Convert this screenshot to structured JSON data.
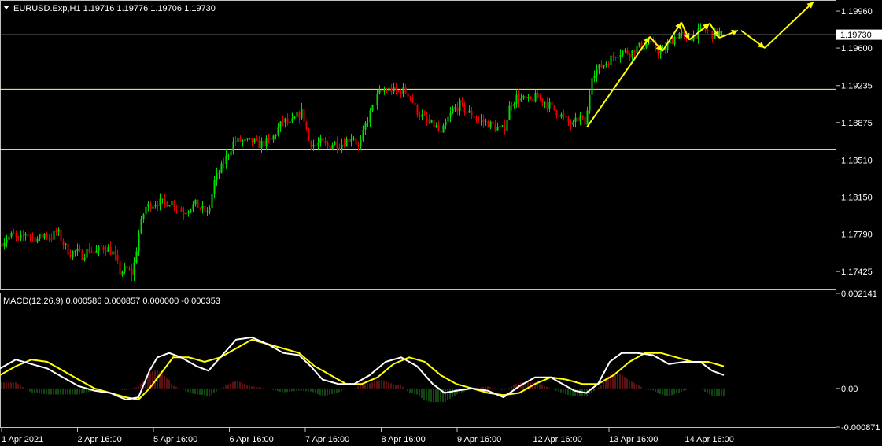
{
  "header": {
    "symbol_line": "EURUSD.Exp,H1  1.19716 1.19776 1.19706 1.19730",
    "macd_line": "MACD(12,26,9) 0.000586 0.000857 0.000000 -0.000353"
  },
  "colors": {
    "background": "#000000",
    "bull": "#00dd00",
    "bear": "#e00000",
    "level_line": "#ffff66",
    "arrow": "#ffff00",
    "macd_main": "#ffffff",
    "macd_signal": "#ffff00",
    "hist_pos": "#b22222",
    "hist_neg": "#228b22",
    "axis_line": "#c0c0c0"
  },
  "chart_data": [
    {
      "type": "candlestick",
      "symbol": "EURUSD.Exp",
      "timeframe": "H1",
      "last_price": "1.19730",
      "ylim": [
        1.1725,
        1.2006
      ],
      "y_ticks": [
        "1.19960",
        "1.19600",
        "1.19235",
        "1.18875",
        "1.18510",
        "1.18150",
        "1.17790",
        "1.17425"
      ],
      "y_tick_values": [
        1.1996,
        1.196,
        1.19235,
        1.18875,
        1.1851,
        1.1815,
        1.1779,
        1.17425
      ],
      "x_labels": [
        "1 Apr 2021",
        "2 Apr 16:00",
        "5 Apr 16:00",
        "6 Apr 16:00",
        "7 Apr 16:00",
        "8 Apr 16:00",
        "9 Apr 16:00",
        "12 Apr 16:00",
        "13 Apr 16:00",
        "14 Apr 16:00"
      ],
      "levels": [
        1.192,
        1.1861
      ],
      "close_path": [
        [
          0,
          1.177
        ],
        [
          8,
          1.1775
        ],
        [
          16,
          1.1778
        ],
        [
          24,
          1.1772
        ],
        [
          32,
          1.178
        ],
        [
          40,
          1.1776
        ],
        [
          48,
          1.1774
        ],
        [
          56,
          1.1779
        ],
        [
          64,
          1.1775
        ],
        [
          72,
          1.1782
        ],
        [
          80,
          1.177
        ],
        [
          88,
          1.176
        ],
        [
          96,
          1.1762
        ],
        [
          104,
          1.1758
        ],
        [
          112,
          1.1764
        ],
        [
          120,
          1.176
        ],
        [
          128,
          1.1766
        ],
        [
          136,
          1.1765
        ],
        [
          144,
          1.176
        ],
        [
          152,
          1.1742
        ],
        [
          160,
          1.1745
        ],
        [
          168,
          1.174
        ],
        [
          176,
          1.178
        ],
        [
          184,
          1.1805
        ],
        [
          192,
          1.1808
        ],
        [
          200,
          1.181
        ],
        [
          208,
          1.1809
        ],
        [
          216,
          1.1811
        ],
        [
          224,
          1.1807
        ],
        [
          232,
          1.18
        ],
        [
          240,
          1.1805
        ],
        [
          248,
          1.1808
        ],
        [
          256,
          1.1803
        ],
        [
          264,
          1.1798
        ],
        [
          272,
          1.183
        ],
        [
          280,
          1.1842
        ],
        [
          288,
          1.1855
        ],
        [
          296,
          1.1868
        ],
        [
          304,
          1.187
        ],
        [
          312,
          1.1868
        ],
        [
          320,
          1.1869
        ],
        [
          328,
          1.1866
        ],
        [
          336,
          1.1868
        ],
        [
          344,
          1.187
        ],
        [
          352,
          1.188
        ],
        [
          360,
          1.189
        ],
        [
          368,
          1.1885
        ],
        [
          376,
          1.1893
        ],
        [
          384,
          1.1898
        ],
        [
          392,
          1.187
        ],
        [
          400,
          1.1865
        ],
        [
          408,
          1.1868
        ],
        [
          416,
          1.1864
        ],
        [
          424,
          1.1868
        ],
        [
          432,
          1.1866
        ],
        [
          440,
          1.187
        ],
        [
          448,
          1.1875
        ],
        [
          456,
          1.1862
        ],
        [
          464,
          1.1885
        ],
        [
          472,
          1.19
        ],
        [
          480,
          1.1915
        ],
        [
          488,
          1.1918
        ],
        [
          496,
          1.192
        ],
        [
          504,
          1.1917
        ],
        [
          512,
          1.1919
        ],
        [
          520,
          1.1915
        ],
        [
          528,
          1.19
        ],
        [
          536,
          1.1893
        ],
        [
          544,
          1.1887
        ],
        [
          552,
          1.1885
        ],
        [
          560,
          1.1875
        ],
        [
          568,
          1.189
        ],
        [
          576,
          1.19
        ],
        [
          584,
          1.1905
        ],
        [
          592,
          1.1898
        ],
        [
          600,
          1.1895
        ],
        [
          608,
          1.189
        ],
        [
          616,
          1.1888
        ],
        [
          624,
          1.1885
        ],
        [
          632,
          1.1882
        ],
        [
          640,
          1.188
        ],
        [
          648,
          1.1905
        ],
        [
          656,
          1.1912
        ],
        [
          664,
          1.191
        ],
        [
          672,
          1.1908
        ],
        [
          680,
          1.1912
        ],
        [
          688,
          1.191
        ],
        [
          696,
          1.1905
        ],
        [
          704,
          1.19
        ],
        [
          712,
          1.1895
        ],
        [
          720,
          1.1888
        ],
        [
          728,
          1.1885
        ],
        [
          736,
          1.1893
        ],
        [
          744,
          1.1885
        ],
        [
          752,
          1.1935
        ],
        [
          760,
          1.194
        ],
        [
          768,
          1.1945
        ],
        [
          776,
          1.195
        ],
        [
          784,
          1.1955
        ],
        [
          792,
          1.1957
        ],
        [
          800,
          1.1955
        ],
        [
          808,
          1.196
        ],
        [
          816,
          1.1962
        ],
        [
          824,
          1.1965
        ],
        [
          832,
          1.196
        ],
        [
          840,
          1.1955
        ],
        [
          848,
          1.1962
        ],
        [
          856,
          1.197
        ],
        [
          864,
          1.1975
        ],
        [
          872,
          1.1968
        ],
        [
          880,
          1.1972
        ],
        [
          888,
          1.1975
        ],
        [
          896,
          1.1978
        ],
        [
          904,
          1.1973
        ],
        [
          912,
          1.1976
        ],
        [
          918,
          1.1973
        ]
      ],
      "arrows": [
        [
          [
            746,
            1.1883
          ],
          [
            826,
            1.1971
          ]
        ],
        [
          [
            826,
            1.1971
          ],
          [
            842,
            1.1957
          ]
        ],
        [
          [
            842,
            1.1957
          ],
          [
            866,
            1.1985
          ]
        ],
        [
          [
            866,
            1.1985
          ],
          [
            876,
            1.1968
          ]
        ],
        [
          [
            876,
            1.1968
          ],
          [
            902,
            1.1984
          ]
        ],
        [
          [
            902,
            1.1984
          ],
          [
            914,
            1.197
          ]
        ],
        [
          [
            914,
            1.197
          ],
          [
            938,
            1.1977
          ]
        ],
        [
          [
            942,
            1.1977
          ],
          [
            972,
            1.196
          ]
        ],
        [
          [
            972,
            1.196
          ],
          [
            1034,
            1.2005
          ]
        ]
      ]
    },
    {
      "type": "line",
      "indicator": "MACD(12,26,9)",
      "ylim": [
        -0.000871,
        0.002141
      ],
      "y_ticks": [
        "0.002141",
        "0.00",
        "-0.000871"
      ],
      "y_tick_values": [
        0.002141,
        0.0,
        -0.000871
      ],
      "series": [
        {
          "role": "main",
          "points": [
            [
              0,
              0.00045
            ],
            [
              20,
              0.00065
            ],
            [
              40,
              0.00055
            ],
            [
              60,
              0.00045
            ],
            [
              80,
              0.00025
            ],
            [
              100,
              5e-05
            ],
            [
              120,
              -5e-05
            ],
            [
              140,
              -0.0001
            ],
            [
              160,
              -0.00025
            ],
            [
              176,
              -0.0002
            ],
            [
              190,
              0.0004
            ],
            [
              200,
              0.0007
            ],
            [
              215,
              0.0008
            ],
            [
              230,
              0.0007
            ],
            [
              250,
              0.0005
            ],
            [
              265,
              0.0004
            ],
            [
              280,
              0.0007
            ],
            [
              300,
              0.0011
            ],
            [
              320,
              0.00115
            ],
            [
              340,
              0.001
            ],
            [
              360,
              0.0008
            ],
            [
              380,
              0.00075
            ],
            [
              395,
              0.0005
            ],
            [
              410,
              0.0002
            ],
            [
              430,
              0.0001
            ],
            [
              450,
              0.0001
            ],
            [
              470,
              0.0003
            ],
            [
              490,
              0.0006
            ],
            [
              510,
              0.0007
            ],
            [
              530,
              0.0005
            ],
            [
              550,
              0.0001
            ],
            [
              565,
              -0.0001
            ],
            [
              580,
              -5e-05
            ],
            [
              600,
              0.0
            ],
            [
              620,
              -5e-05
            ],
            [
              640,
              -0.0002
            ],
            [
              660,
              5e-05
            ],
            [
              680,
              0.00025
            ],
            [
              700,
              0.00025
            ],
            [
              715,
              0.0001
            ],
            [
              730,
              -5e-05
            ],
            [
              745,
              -0.0001
            ],
            [
              760,
              0.0001
            ],
            [
              775,
              0.0006
            ],
            [
              790,
              0.0008
            ],
            [
              810,
              0.0008
            ],
            [
              830,
              0.00075
            ],
            [
              850,
              0.00055
            ],
            [
              870,
              0.0006
            ],
            [
              890,
              0.0006
            ],
            [
              905,
              0.0004
            ],
            [
              920,
              0.0003
            ]
          ]
        },
        {
          "role": "signal",
          "points": [
            [
              0,
              0.0003
            ],
            [
              20,
              0.0005
            ],
            [
              40,
              0.00065
            ],
            [
              60,
              0.0006
            ],
            [
              80,
              0.0004
            ],
            [
              100,
              0.0002
            ],
            [
              120,
              0.0
            ],
            [
              140,
              -0.0001
            ],
            [
              160,
              -0.0002
            ],
            [
              176,
              -0.00025
            ],
            [
              190,
              0.0
            ],
            [
              205,
              0.00035
            ],
            [
              220,
              0.0007
            ],
            [
              240,
              0.0007
            ],
            [
              260,
              0.0006
            ],
            [
              280,
              0.0007
            ],
            [
              300,
              0.0009
            ],
            [
              320,
              0.0011
            ],
            [
              340,
              0.001
            ],
            [
              360,
              0.0009
            ],
            [
              380,
              0.0008
            ],
            [
              400,
              0.0005
            ],
            [
              420,
              0.0003
            ],
            [
              440,
              0.0001
            ],
            [
              460,
              0.0001
            ],
            [
              480,
              0.00025
            ],
            [
              500,
              0.00055
            ],
            [
              520,
              0.0007
            ],
            [
              540,
              0.0006
            ],
            [
              560,
              0.0003
            ],
            [
              580,
              0.0001
            ],
            [
              600,
              0.0
            ],
            [
              620,
              -0.0001
            ],
            [
              640,
              -0.00015
            ],
            [
              660,
              -0.0001
            ],
            [
              680,
              0.0001
            ],
            [
              700,
              0.00025
            ],
            [
              720,
              0.0002
            ],
            [
              740,
              0.0001
            ],
            [
              760,
              0.0001
            ],
            [
              780,
              0.0003
            ],
            [
              800,
              0.0006
            ],
            [
              820,
              0.0008
            ],
            [
              840,
              0.0008
            ],
            [
              860,
              0.0007
            ],
            [
              880,
              0.0006
            ],
            [
              900,
              0.0006
            ],
            [
              920,
              0.0005
            ]
          ]
        }
      ],
      "histogram_note": "OsMA histogram = main - signal"
    }
  ]
}
